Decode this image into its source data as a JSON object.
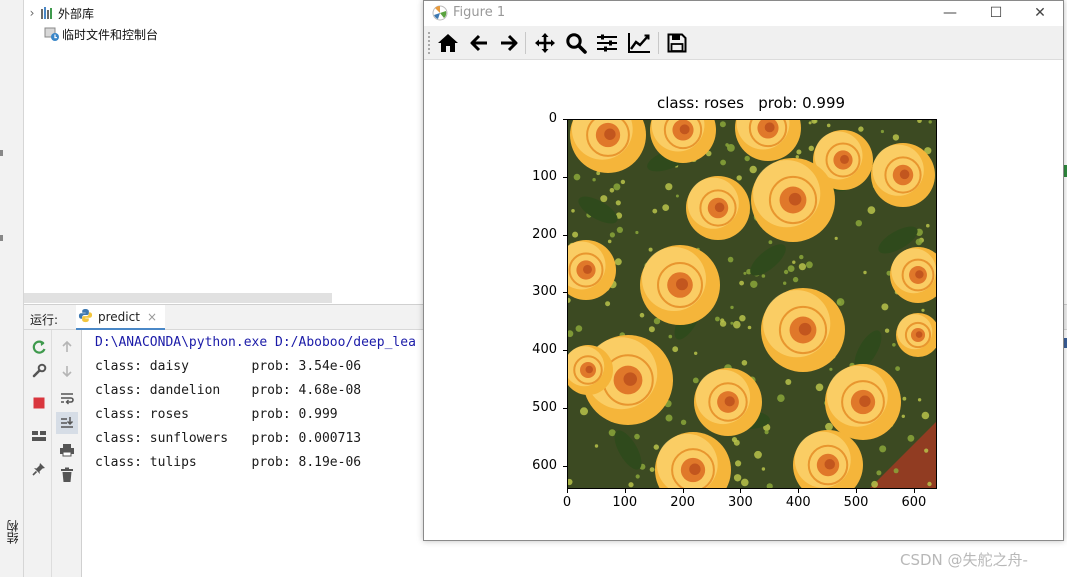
{
  "project_tree": {
    "items": [
      {
        "label": "外部库",
        "icon": "library-icon"
      },
      {
        "label": "临时文件和控制台",
        "icon": "scratches-icon"
      }
    ]
  },
  "left_strip": {
    "vertical_tab": "结构"
  },
  "run_panel": {
    "label": "运行:",
    "tab_label": "predict",
    "tab_close": "×",
    "console_lines": [
      {
        "text": "D:\\ANACONDA\\python.exe D:/Aboboo/deep_lea",
        "kind": "cmd"
      },
      {
        "text": "class: daisy        prob: 3.54e-06",
        "kind": "out"
      },
      {
        "text": "class: dandelion    prob: 4.68e-08",
        "kind": "out"
      },
      {
        "text": "class: roses        prob: 0.999",
        "kind": "out"
      },
      {
        "text": "class: sunflowers   prob: 0.000713",
        "kind": "out"
      },
      {
        "text": "class: tulips       prob: 8.19e-06",
        "kind": "out"
      }
    ],
    "toolbar_icons": [
      "rerun-icon",
      "wrench-icon",
      "stop-icon",
      "layout-icon",
      "pin-icon",
      "up-arrow-icon",
      "down-arrow-icon",
      "soft-wrap-icon",
      "scroll-to-end-icon",
      "print-icon",
      "trash-icon"
    ]
  },
  "figure_window": {
    "title": "Figure 1",
    "window_buttons": {
      "minimize": "—",
      "maximize": "☐",
      "close": "✕"
    },
    "toolbar_icons": [
      "home-icon",
      "back-icon",
      "forward-icon",
      "pan-icon",
      "zoom-icon",
      "subplots-icon",
      "edit-axes-icon",
      "save-icon"
    ],
    "plot_title": "class: roses   prob: 0.999",
    "image_description_colors": {
      "background": "#3c4a22",
      "petal": "#f5b53a",
      "petal_light": "#fcd776",
      "center": "#e0782a",
      "filler": "#8aa63a"
    }
  },
  "chart_data": {
    "type": "image",
    "title": "class: roses   prob: 0.999",
    "x_ticks": [
      "0",
      "100",
      "200",
      "300",
      "400",
      "500",
      "600"
    ],
    "y_ticks": [
      "0",
      "100",
      "200",
      "300",
      "400",
      "500",
      "600"
    ],
    "xlim": [
      0,
      640
    ],
    "ylim": [
      640,
      0
    ]
  },
  "watermark": "CSDN @失舵之舟-"
}
